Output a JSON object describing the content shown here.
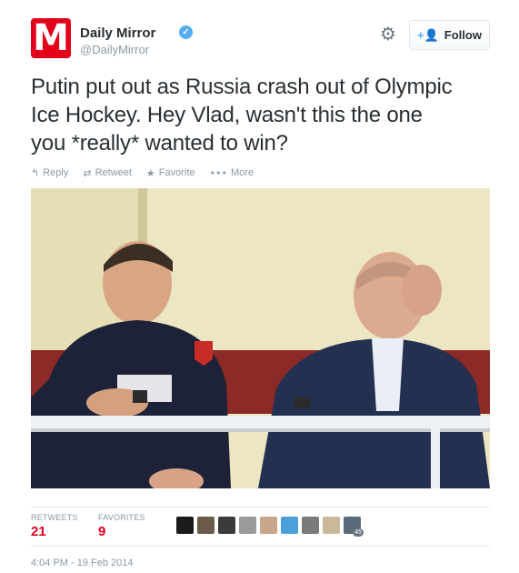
{
  "user": {
    "name": "Daily Mirror",
    "handle": "@DailyMirror",
    "avatar_letter": "M",
    "verified_icon": "verified-badge-icon"
  },
  "follow": {
    "label": "Follow",
    "icon": "add-user-icon"
  },
  "settings_icon": "gear-icon",
  "tweet": {
    "text_lines": [
      "Putin put out as Russia crash out of Olympic",
      "Ice Hockey. Hey Vlad, wasn't this the one",
      "you *really* wanted to win?"
    ]
  },
  "actions": [
    {
      "label": "Reply",
      "icon": "reply-icon"
    },
    {
      "label": "Retweet",
      "icon": "retweet-icon"
    },
    {
      "label": "Favorite",
      "icon": "star-icon"
    },
    {
      "label": "More",
      "icon": "more-dots-icon"
    }
  ],
  "stats": {
    "retweets_label": "RETWEETS",
    "retweets_count": "21",
    "favorites_label": "FAVORITES",
    "favorites_count": "9",
    "favoriter_avatars": [
      "#1a1a1a",
      "#6b5b4a",
      "#3b3b3b",
      "#9a9a9a",
      "#c9a58a",
      "#4aa0d8",
      "#7a7a7a",
      "#c9b89a",
      "#5a6a7a"
    ],
    "avatar_overflow_badge": "45"
  },
  "timestamp": "4:04 PM - 19 Feb 2014",
  "colors": {
    "brand": "#e3001b",
    "link": "#55acee",
    "muted": "#8899a6"
  }
}
